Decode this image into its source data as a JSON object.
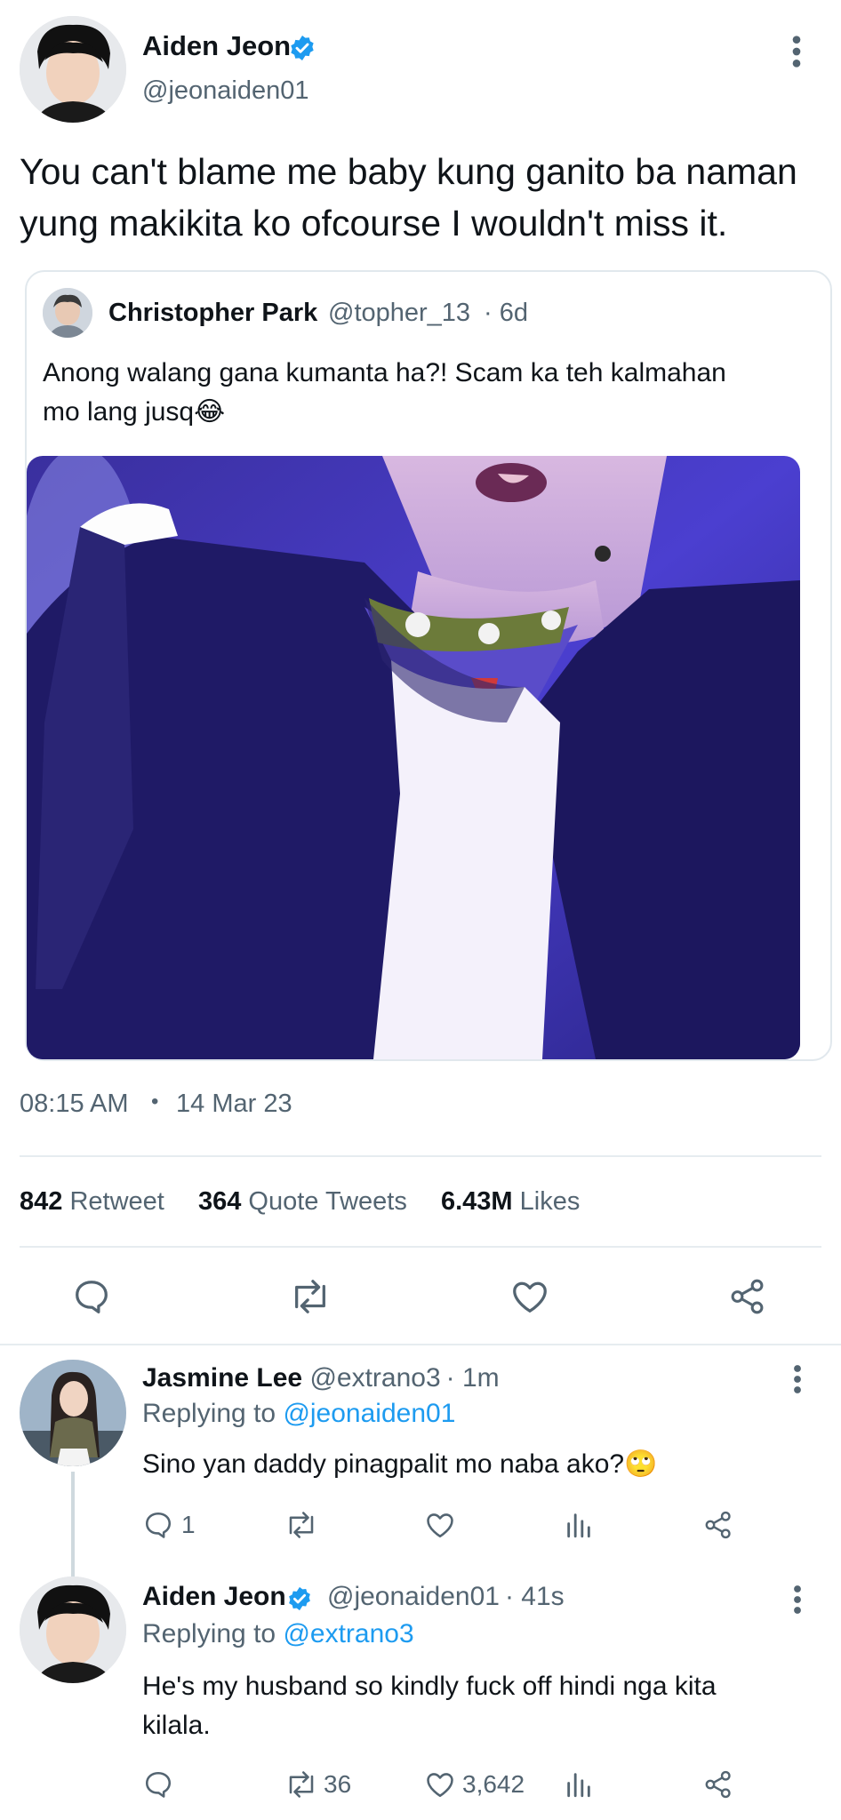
{
  "main_tweet": {
    "author_name": "Aiden Jeon",
    "author_handle": "@jeonaiden01",
    "text": "You can't blame me baby kung ganito ba naman yung makikita ko ofcourse I wouldn't miss it.",
    "quoted": {
      "author_name": "Christopher Park",
      "author_handle": "@topher_13",
      "age": "· 6d",
      "text_line1": "Anong walang gana kumanta ha?! Scam ka teh kalmahan",
      "text_line2": "mo lang jusq",
      "emoji": "😂"
    },
    "time": "08:15 AM",
    "dot": "•",
    "date": "14 Mar 23",
    "stats": {
      "retweets_count": "842",
      "retweets_label": "Retweet",
      "quotes_count": "364",
      "quotes_label": "Quote Tweets",
      "likes_count": "6.43M",
      "likes_label": "Likes"
    }
  },
  "replies": [
    {
      "author_name": "Jasmine Lee",
      "author_handle": "@extrano3",
      "age": "· 1m",
      "replying_label": "Replying to",
      "replying_to": "@jeonaiden01",
      "text": "Sino yan daddy pinagpalit mo naba ako?",
      "emoji": "🙄",
      "reply_count": "1",
      "retweet_count": "",
      "like_count": ""
    },
    {
      "author_name": "Aiden Jeon",
      "author_handle": "@jeonaiden01",
      "age": "· 41s",
      "replying_label": "Replying to",
      "replying_to": "@extrano3",
      "text_line1": "He's my husband so kindly fuck off hindi nga kita",
      "text_line2": "kilala.",
      "reply_count": "",
      "retweet_count": "36",
      "like_count": "3,642"
    }
  ],
  "colors": {
    "accent": "#1d9bf0",
    "text": "#0f1419",
    "muted": "#536471",
    "divider": "#e6ecf0"
  }
}
